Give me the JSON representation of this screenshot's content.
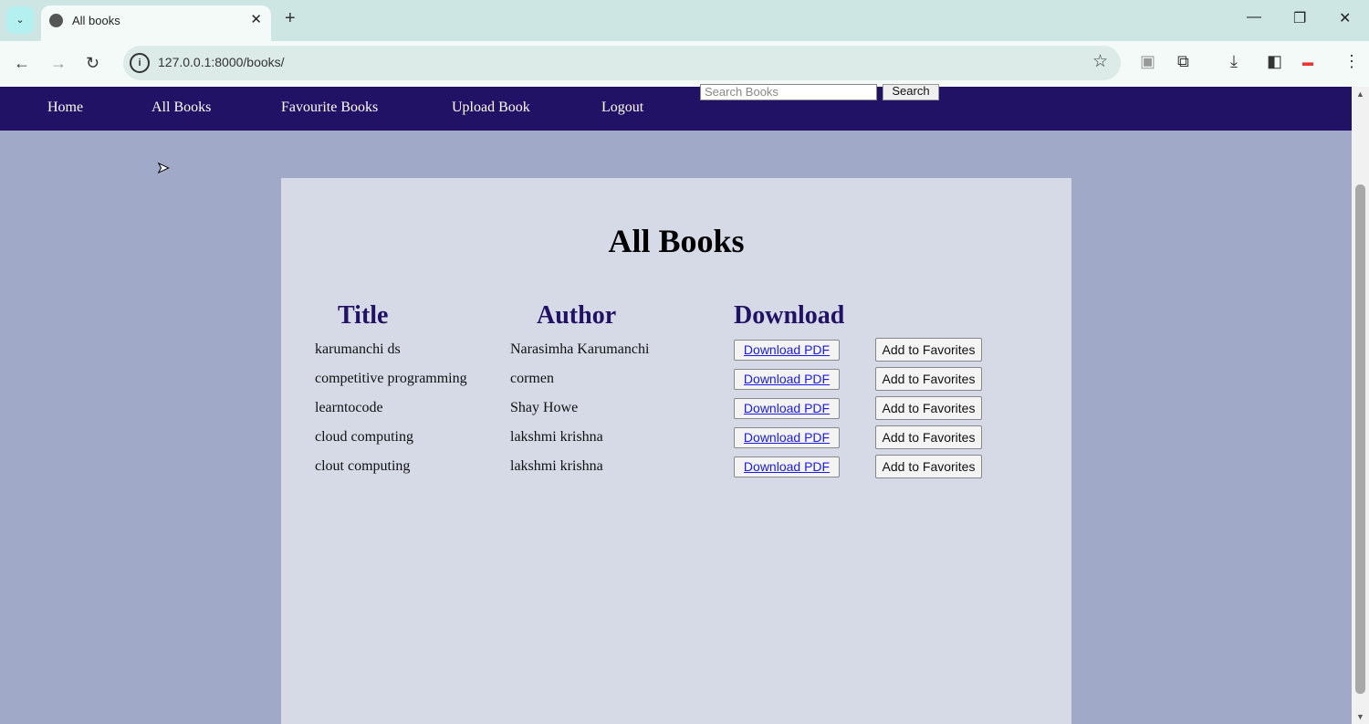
{
  "browser": {
    "tab_title": "All books",
    "url": "127.0.0.1:8000/books/"
  },
  "nav": {
    "items": [
      "Home",
      "All Books",
      "Favourite Books",
      "Upload Book",
      "Logout"
    ],
    "search_placeholder": "Search Books",
    "search_button": "Search"
  },
  "main": {
    "heading": "All Books",
    "columns": [
      "Title",
      "Author",
      "Download"
    ],
    "download_label": "Download PDF",
    "favorite_label": "Add to Favorites",
    "books": [
      {
        "title": "karumanchi ds",
        "author": "Narasimha Karumanchi"
      },
      {
        "title": "competitive programming",
        "author": "cormen"
      },
      {
        "title": "learntocode",
        "author": "Shay Howe"
      },
      {
        "title": "cloud computing",
        "author": "lakshmi krishna"
      },
      {
        "title": "clout computing",
        "author": "lakshmi krishna"
      }
    ]
  },
  "colors": {
    "nav_bg": "#221266",
    "page_bg": "#a0a9c8",
    "card_bg": "#d6dae6",
    "heading": "#221266"
  }
}
